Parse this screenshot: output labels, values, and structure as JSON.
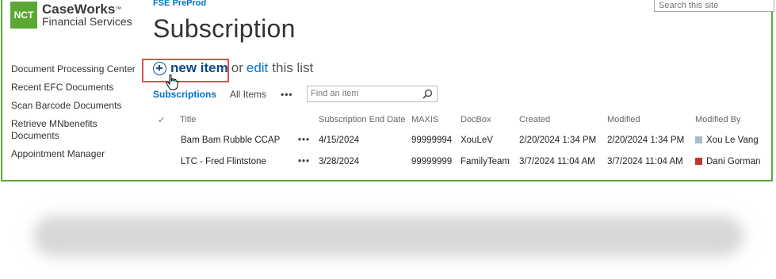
{
  "logo": {
    "mark": "NCT",
    "main": "CaseWorks",
    "tm": "™",
    "sub": "Financial Services"
  },
  "breadcrumb": "FSE PreProd",
  "search_site": {
    "placeholder": "Search this site"
  },
  "page_title": "Subscription",
  "sidenav": {
    "items": [
      {
        "label": "Document Processing Center"
      },
      {
        "label": "Recent EFC Documents"
      },
      {
        "label": "Scan Barcode Documents"
      },
      {
        "label": "Retrieve MNbenefits Documents"
      },
      {
        "label": "Appointment Manager"
      }
    ]
  },
  "command_bar": {
    "new_item": "new item",
    "or": "or",
    "edit": "edit",
    "this_list": "this list"
  },
  "views": {
    "active": "Subscriptions",
    "all": "All Items",
    "more": "•••"
  },
  "find": {
    "placeholder": "Find an item"
  },
  "table": {
    "headers": {
      "check": "✓",
      "title": "Title",
      "end_date": "Subscription End Date",
      "maxis": "MAXIS",
      "docbox": "DocBox",
      "created": "Created",
      "modified": "Modified",
      "modified_by": "Modified By"
    },
    "rows": [
      {
        "title": "Bam Bam Rubble CCAP",
        "menu": "•••",
        "end_date": "4/15/2024",
        "maxis": "99999994",
        "docbox": "XouLeV",
        "created": "2/20/2024 1:34 PM",
        "modified": "2/20/2024 1:34 PM",
        "modified_by": "Xou Le Vang",
        "user_color": "#a9bccb"
      },
      {
        "title": "LTC - Fred Flintstone",
        "menu": "•••",
        "end_date": "3/28/2024",
        "maxis": "99999999",
        "docbox": "FamilyTeam",
        "created": "3/7/2024 11:04 AM",
        "modified": "3/7/2024 11:04 AM",
        "modified_by": "Dani Gorman",
        "user_color": "#c0392b"
      }
    ]
  },
  "colors": {
    "frame": "#58a83a",
    "link": "#0072c6",
    "highlight": "#e05050",
    "logo": "#5aa832"
  }
}
